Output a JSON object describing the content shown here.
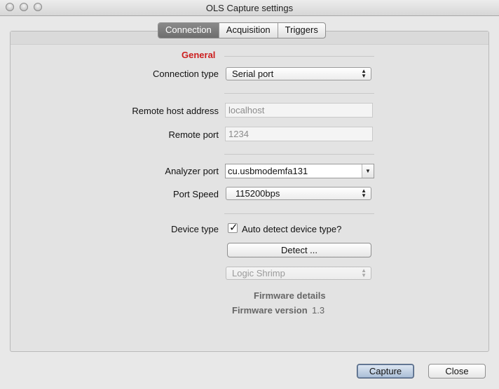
{
  "window": {
    "title": "OLS Capture settings"
  },
  "tabs": [
    {
      "label": "Connection",
      "active": true
    },
    {
      "label": "Acquisition",
      "active": false
    },
    {
      "label": "Triggers",
      "active": false
    }
  ],
  "general": {
    "section_title": "General",
    "connection_type": {
      "label": "Connection type",
      "value": "Serial port"
    },
    "remote_host": {
      "label": "Remote host address",
      "value": "localhost"
    },
    "remote_port": {
      "label": "Remote port",
      "value": "1234"
    },
    "analyzer_port": {
      "label": "Analyzer port",
      "value": "cu.usbmodemfa131"
    },
    "port_speed": {
      "label": "Port Speed",
      "value": "115200bps"
    },
    "device_type": {
      "label": "Device type",
      "auto_detect_label": "Auto detect device type?",
      "auto_detect_checked": true,
      "detect_button": "Detect ...",
      "device_value": "Logic Shrimp"
    },
    "firmware": {
      "details_label": "Firmware details",
      "version_label": "Firmware version",
      "version_value": "1.3"
    }
  },
  "footer": {
    "capture_button": "Capture",
    "close_button": "Close"
  },
  "colors": {
    "section_title": "#cc1e1e",
    "active_tab": "#7a7a7a",
    "primary_button": "#a9bdd6"
  }
}
